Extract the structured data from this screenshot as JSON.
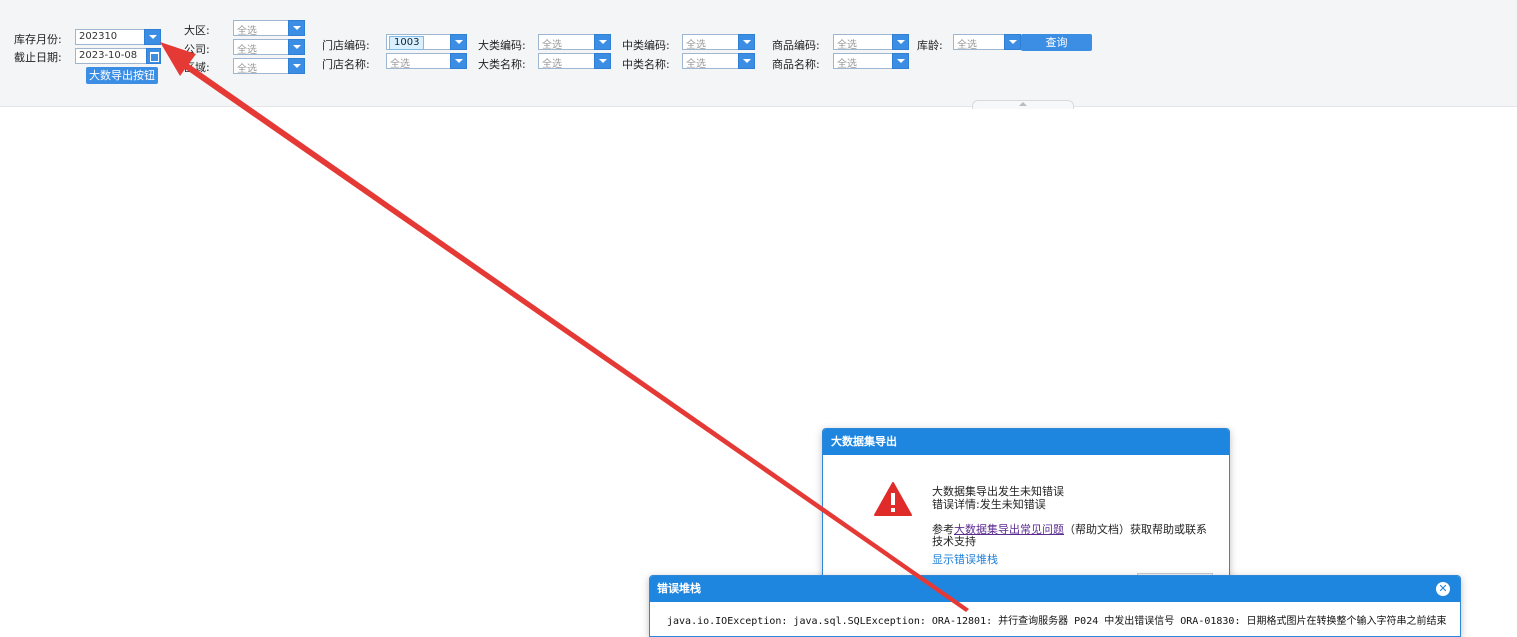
{
  "params": {
    "stock_month_label": "库存月份:",
    "stock_month_value": "202310",
    "cutoff_date_label": "截止日期:",
    "cutoff_date_value": "2023-10-08",
    "export_button": "大数导出按钮",
    "region_label": "大区:",
    "company_label": "公司:",
    "district_label": "区域:",
    "select_all": "全选",
    "store_code_label": "门店编码:",
    "store_code_value": "1003",
    "store_name_label": "门店名称:",
    "major_code_label": "大类编码:",
    "major_name_label": "大类名称:",
    "mid_code_label": "中类编码:",
    "mid_name_label": "中类名称:",
    "product_code_label": "商品编码:",
    "product_name_label": "商品名称:",
    "stock_age_label": "库龄:",
    "query_button": "查询"
  },
  "dialog": {
    "title": "大数据集导出",
    "message_line1": "大数据集导出发生未知错误",
    "message_line2": "错误详情:发生未知错误",
    "help_prefix": "参考",
    "help_link": "大数据集导出常见问题",
    "help_suffix": "（帮助文档）获取帮助或联系",
    "help_line2": "技术支持",
    "show_stack_link": "显示错误堆栈"
  },
  "stack_dialog": {
    "title": "错误堆栈",
    "error_text": "java.io.IOException: java.sql.SQLException: ORA-12801: 并行查询服务器 P024 中发出错误信号 ORA-01830: 日期格式图片在转换整个输入字符串之前结束"
  },
  "colors": {
    "accent_blue": "#1f86e0",
    "annotation_arrow": "#e53935",
    "warning_red": "#e02b2b"
  },
  "icons": [
    "dropdown-arrow-icon",
    "calendar-icon",
    "warning-icon",
    "close-icon",
    "collapse-arrow-icon"
  ]
}
